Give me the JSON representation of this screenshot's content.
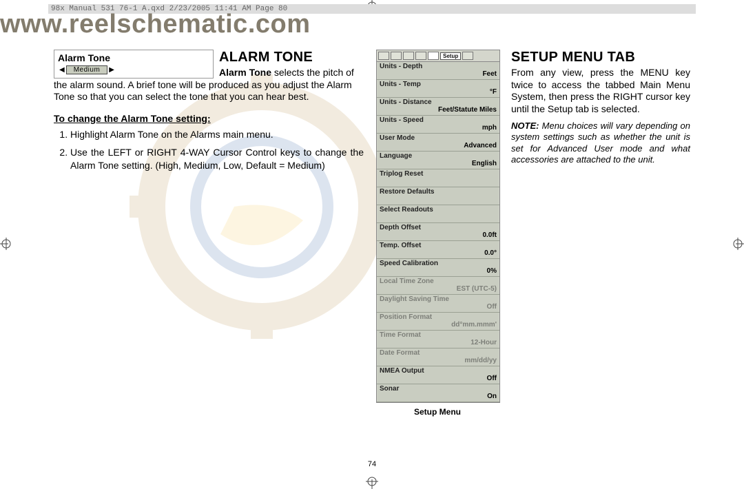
{
  "header": "98x Manual 531 76-1 A.qxd   2/23/2005  11:41 AM   Page 80",
  "watermark_url": "www.reelschematic.com",
  "page_number": "74",
  "left": {
    "inset_title": "Alarm Tone",
    "inset_value": "Medium",
    "heading": "ALARM TONE",
    "intro_bold": "Alarm Tone",
    "intro_rest": " selects the pitch of the alarm sound. A brief tone will be produced as you adjust the Alarm Tone so that you can select the tone that you can hear best.",
    "subhead": "To change the Alarm Tone setting:",
    "step1": "Highlight Alarm Tone on the Alarms main menu.",
    "step2": "Use the LEFT or RIGHT 4-WAY Cursor Control keys to change the Alarm Tone setting. (High, Medium, Low, Default = Medium)"
  },
  "device": {
    "tab_label": "Setup",
    "caption": "Setup Menu",
    "rows": [
      {
        "label": "Units - Depth",
        "value": "Feet",
        "faded": false
      },
      {
        "label": "Units - Temp",
        "value": "°F",
        "faded": false
      },
      {
        "label": "Units - Distance",
        "value": "Feet/Statute Miles",
        "faded": false
      },
      {
        "label": "Units - Speed",
        "value": "mph",
        "faded": false
      },
      {
        "label": "User Mode",
        "value": "Advanced",
        "faded": false
      },
      {
        "label": "Language",
        "value": "English",
        "faded": false
      },
      {
        "label": "Triplog Reset",
        "value": "",
        "faded": false
      },
      {
        "label": "Restore Defaults",
        "value": "",
        "faded": false
      },
      {
        "label": "Select Readouts",
        "value": "",
        "faded": false
      },
      {
        "label": "Depth Offset",
        "value": "0.0ft",
        "faded": false
      },
      {
        "label": "Temp. Offset",
        "value": "0.0°",
        "faded": false
      },
      {
        "label": "Speed Calibration",
        "value": "0%",
        "faded": false
      },
      {
        "label": "Local Time Zone",
        "value": "EST (UTC-5)",
        "faded": true
      },
      {
        "label": "Daylight Saving Time",
        "value": "Off",
        "faded": true
      },
      {
        "label": "Position Format",
        "value": "dd°mm.mmm'",
        "faded": true
      },
      {
        "label": "Time Format",
        "value": "12-Hour",
        "faded": true
      },
      {
        "label": "Date Format",
        "value": "mm/dd/yy",
        "faded": true
      },
      {
        "label": "NMEA Output",
        "value": "Off",
        "faded": false
      },
      {
        "label": "Sonar",
        "value": "On",
        "faded": false
      }
    ]
  },
  "right": {
    "heading": "SETUP MENU TAB",
    "body": "From any view, press the MENU key twice to access the tabbed Main Menu System, then press the RIGHT cursor key until the Setup tab is selected.",
    "note_bold": "NOTE:",
    "note_rest": " Menu choices will vary depending on system settings such as whether the unit is set for Advanced User mode and what accessories are attached to the unit."
  }
}
